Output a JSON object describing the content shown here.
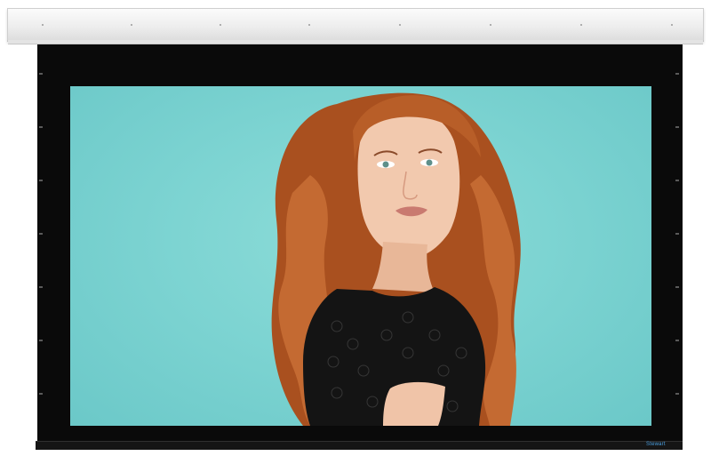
{
  "product": {
    "brand_label": "Stewart"
  },
  "colors": {
    "backdrop": "#7dd4d2",
    "hair": "#b5562a",
    "skin": "#f2c9ae",
    "dress": "#141414",
    "housing": "#eeeeee",
    "screen_border": "#0a0a0a",
    "brand_text": "#4a9fe0"
  }
}
